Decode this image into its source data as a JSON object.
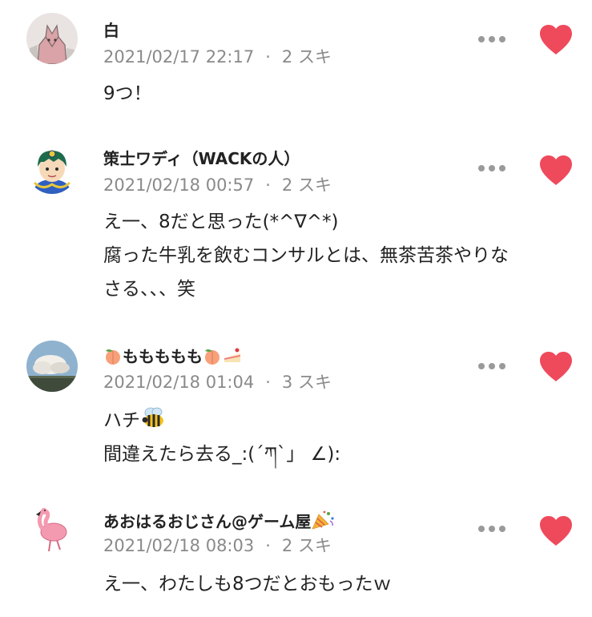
{
  "colors": {
    "heart": "#ee4a5c",
    "meta_text": "#8a8a8a",
    "dots": "#9a9a9a"
  },
  "comments": [
    {
      "name": "白",
      "date": "2021/02/17 22:17",
      "likes": "2 スキ",
      "body": [
        "9つ！"
      ],
      "avatar_icon": "fox-illustration-avatar"
    },
    {
      "name": "策士ワディ（WACKの人）",
      "date": "2021/02/18 00:57",
      "likes": "2 スキ",
      "body": [
        "え一、8だと思った(*^∇^*)",
        "腐った牛乳を飲むコンサルとは、無茶苦茶やりな",
        "さる、、、笑"
      ],
      "avatar_icon": "cartoon-character-avatar"
    },
    {
      "name": "もももももも",
      "name_parts": [
        "ももももも"
      ],
      "date": "2021/02/18 01:04",
      "likes": "3 スキ",
      "body": [
        "ハチ",
        "間違えたら去る_:(´ཀ`」 ∠):"
      ],
      "avatar_icon": "cloud-landscape-avatar",
      "name_icons": [
        "peach-icon",
        "peach-icon",
        "cake-icon"
      ],
      "body_icon": "bee-icon"
    },
    {
      "name": "あおはるおじさん@ゲーム屋",
      "date": "2021/02/18 08:03",
      "likes": "2 スキ",
      "body": [
        "え一、わたしも8つだとおもったｗ"
      ],
      "avatar_icon": "flamingo-avatar",
      "name_icons": [
        "party-popper-icon"
      ]
    }
  ]
}
